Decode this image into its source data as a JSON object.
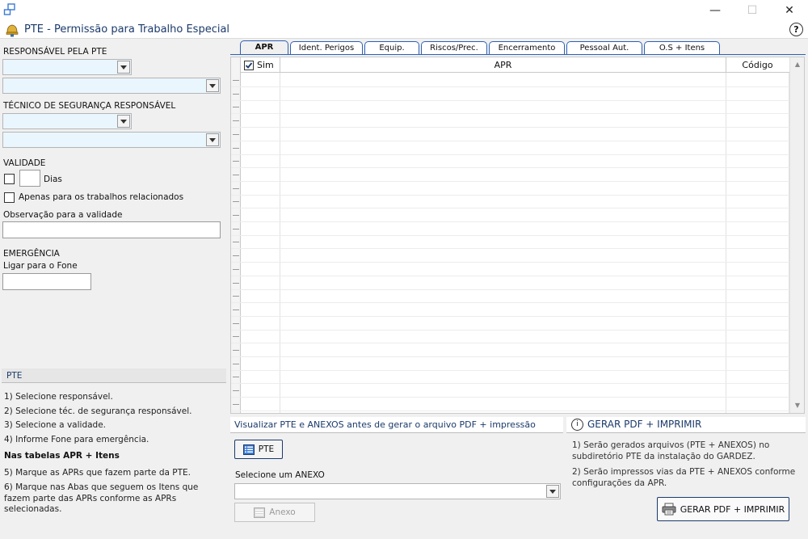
{
  "window": {
    "title": "PTE - Permissão para Trabalho Especial",
    "minimize_glyph": "—",
    "maximize_glyph": "☐",
    "close_glyph": "✕",
    "help_glyph": "?"
  },
  "left": {
    "responsavel_label": "RESPONSÁVEL PELA PTE",
    "tecnico_label": "TÉCNICO DE SEGURANÇA RESPONSÁVEL",
    "validade_label": "VALIDADE",
    "dias_label": "Dias",
    "apenas_label": "Apenas para os trabalhos relacionados",
    "observacao_label": "Observação para a validade",
    "emergencia_label": "EMERGÊNCIA",
    "ligar_label": "Ligar para o Fone",
    "pte_section": "PTE",
    "steps": {
      "s1": "1) Selecione responsável.",
      "s2": "2) Selecione téc. de segurança responsável.",
      "s3": "3) Selecione a validade.",
      "s4": "4) Informe Fone para emergência.",
      "tables": "Nas tabelas APR + Itens",
      "s5": "5) Marque as APRs que fazem parte da PTE.",
      "s6a": "6) Marque nas Abas que seguem os Itens que",
      "s6b": "fazem parte das APRs conforme as APRs",
      "s6c": "selecionadas."
    }
  },
  "tabs": [
    "APR",
    "Ident. Perigos",
    "Equip.",
    "Riscos/Prec.",
    "Encerramento",
    "Pessoal Aut.",
    "O.S + Itens"
  ],
  "grid": {
    "col_sim": "Sim",
    "col_apr": "APR",
    "col_codigo": "Código",
    "scroll_up": "▲",
    "scroll_down": "▼"
  },
  "bottom": {
    "visualizar_label": "Visualizar PTE e ANEXOS antes de gerar o arquivo PDF + impressão",
    "pte_button": "PTE",
    "selecione_anexo_label": "Selecione um ANEXO",
    "anexo_button": "Anexo",
    "gerar_header": "GERAR PDF + IMPRIMIR",
    "info_glyph": "i",
    "info1a": "1) Serão gerados arquivos (PTE + ANEXOS) no",
    "info1b": "subdiretório PTE da instalação do GARDEZ.",
    "info2a": "2) Serão impressos vias da PTE + ANEXOS conforme",
    "info2b": "configurações da APR.",
    "gerar_button": "GERAR PDF + IMPRIMIR"
  },
  "colors": {
    "accent": "#1b3a6b",
    "tab_border": "#2d5fb5",
    "combo_bg": "#eaf6fd"
  }
}
